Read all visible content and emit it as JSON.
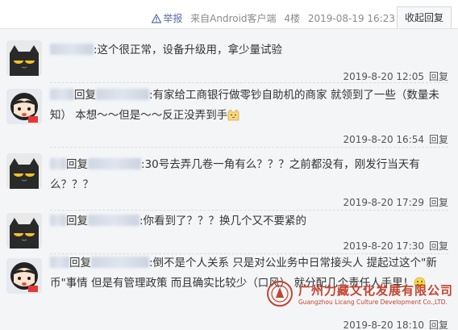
{
  "topbar": {
    "report_label": "举报",
    "source_label": "来自Android客户端",
    "floor_label": "4楼",
    "datetime": "2019-08-19 16:23",
    "fold_reply_label": "收起回复",
    "report_icon": "warning-icon"
  },
  "replies": [
    {
      "avatar_icon": "black-cat-avatar",
      "prefix": "",
      "body": ":这个很正常，设备升级用，拿少量试验",
      "timestamp": "2019-8-20 12:05",
      "reply_label": "回复"
    },
    {
      "avatar_icon": "chibi-girl-avatar",
      "prefix": "回复",
      "body": ":有家给工商银行做零钞自助机的商家 就领到了一些（数量未知） 本想～～但是～～反正没弄到手",
      "emoji_icon": "cat-face-emoji",
      "timestamp": "2019-8-20 16:54",
      "reply_label": "回复"
    },
    {
      "avatar_icon": "black-cat-avatar",
      "prefix": "回复",
      "body": ":30号去弄几卷一角有么？？？之前都没有，刚发行当天有么？？？",
      "timestamp": "2019-8-20 17:29",
      "reply_label": "回复"
    },
    {
      "avatar_icon": "black-cat-avatar",
      "prefix": "回复",
      "body": ":你看到了？？？换几个又不要紧的",
      "timestamp": "2019-8-20 17:30",
      "reply_label": "回复"
    },
    {
      "avatar_icon": "chibi-girl-avatar",
      "prefix": "回复",
      "body": ":倒不是个人关系 只是对公业务中日常接头人 提起过这个\"新币\"事情 但是有管理政策 而且确实比较少（口风） 就分配几个责任人手里！",
      "emoji_icon": "smile-face-emoji",
      "timestamp": "2019-8-20 18:10",
      "reply_label": "回复"
    }
  ],
  "watermark": {
    "company_cn": "广州力藏文化发展有限公司",
    "company_en": "Guangzhou Licang Culture Development Co.,LTD."
  },
  "colors": {
    "panel_bg": "#f4f5f7",
    "link_blue": "#5a6ea8",
    "watermark_red": "#c2452f"
  }
}
